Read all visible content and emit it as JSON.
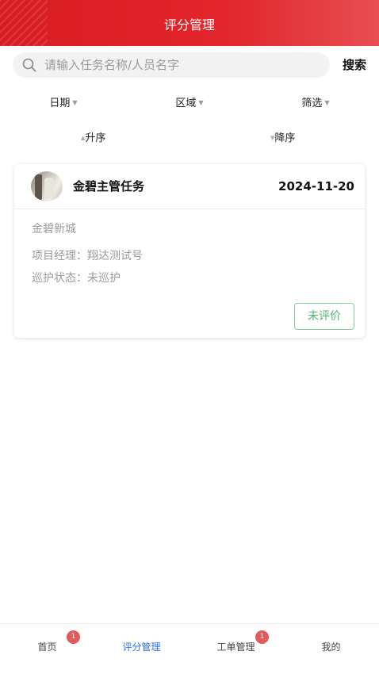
{
  "header": {
    "title": "评分管理"
  },
  "search": {
    "placeholder": "请输入任务名称/人员名字",
    "value": "",
    "button_label": "搜索"
  },
  "filters": [
    {
      "label": "日期"
    },
    {
      "label": "区域"
    },
    {
      "label": "筛选"
    }
  ],
  "sorts": [
    {
      "label": "升序"
    },
    {
      "label": "降序"
    }
  ],
  "tasks": [
    {
      "name": "金碧主管任务",
      "date": "2024-11-20",
      "community": "金碧新城",
      "manager_line": "项目经理：翔达测试号",
      "patrol_line": "巡护状态：未巡护",
      "status_button": "未评价"
    }
  ],
  "tabbar": {
    "items": [
      {
        "label": "首页",
        "badge": "1",
        "active": false
      },
      {
        "label": "评分管理",
        "badge": "",
        "active": true
      },
      {
        "label": "工单管理",
        "badge": "1",
        "active": false
      },
      {
        "label": "我的",
        "badge": "",
        "active": false
      }
    ]
  },
  "colors": {
    "header_red": "#e1252a",
    "active_tab_blue": "#2f6ee8",
    "status_green": "#4cb96c",
    "badge_red": "#e35a5a"
  }
}
